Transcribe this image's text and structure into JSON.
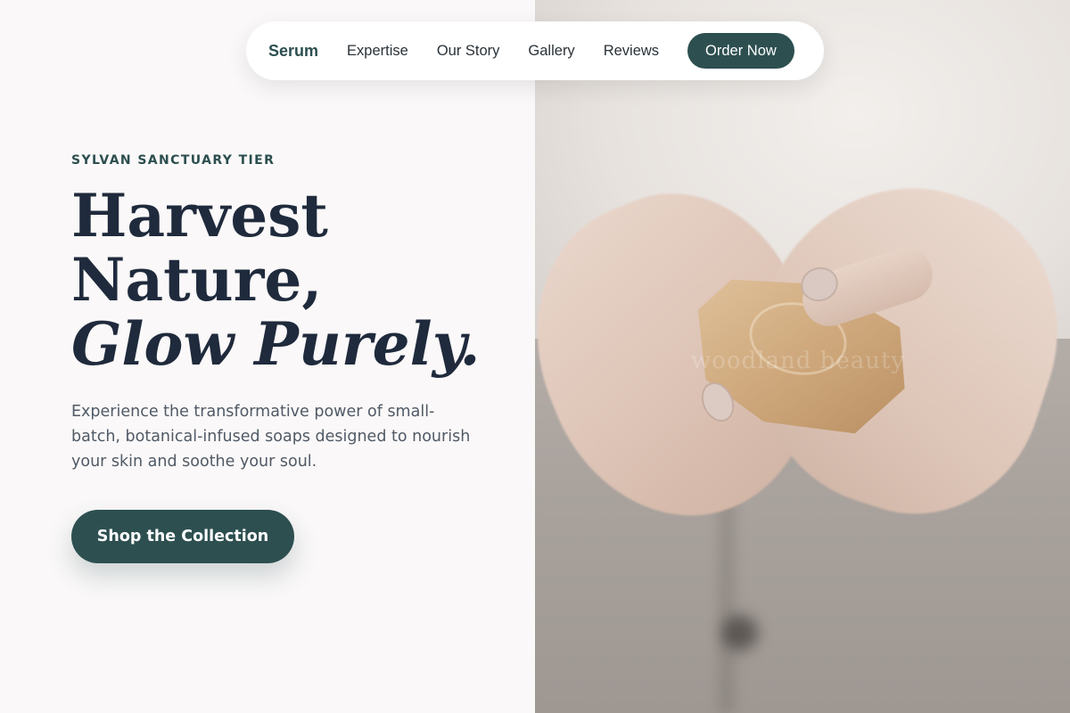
{
  "nav": {
    "brand": "Serum",
    "links": [
      "Expertise",
      "Our Story",
      "Gallery",
      "Reviews"
    ],
    "cta": "Order Now"
  },
  "hero": {
    "eyebrow": "SYLVAN SANCTUARY TIER",
    "headline_line1": "Harvest",
    "headline_line2": "Nature,",
    "headline_line3": "Glow Purely.",
    "lede": "Experience the transformative power of small-batch, botanical-infused soaps designed to nourish your skin and soothe your soul.",
    "cta": "Shop the Collection"
  },
  "image": {
    "watermark": "woodland beauty"
  },
  "colors": {
    "accent": "#2d4f50",
    "heading": "#1f2a3c",
    "body_text": "#505a66",
    "background": "#faf8f8"
  }
}
